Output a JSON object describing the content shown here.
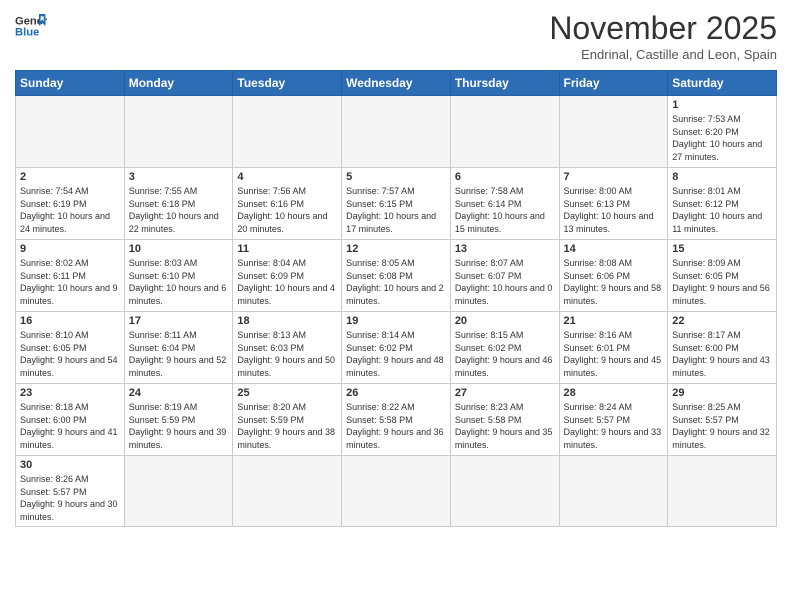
{
  "logo": {
    "line1": "General",
    "line2": "Blue"
  },
  "title": "November 2025",
  "subtitle": "Endrinal, Castille and Leon, Spain",
  "weekdays": [
    "Sunday",
    "Monday",
    "Tuesday",
    "Wednesday",
    "Thursday",
    "Friday",
    "Saturday"
  ],
  "weeks": [
    [
      {
        "day": "",
        "info": ""
      },
      {
        "day": "",
        "info": ""
      },
      {
        "day": "",
        "info": ""
      },
      {
        "day": "",
        "info": ""
      },
      {
        "day": "",
        "info": ""
      },
      {
        "day": "",
        "info": ""
      },
      {
        "day": "1",
        "info": "Sunrise: 7:53 AM\nSunset: 6:20 PM\nDaylight: 10 hours\nand 27 minutes."
      }
    ],
    [
      {
        "day": "2",
        "info": "Sunrise: 7:54 AM\nSunset: 6:19 PM\nDaylight: 10 hours\nand 24 minutes."
      },
      {
        "day": "3",
        "info": "Sunrise: 7:55 AM\nSunset: 6:18 PM\nDaylight: 10 hours\nand 22 minutes."
      },
      {
        "day": "4",
        "info": "Sunrise: 7:56 AM\nSunset: 6:16 PM\nDaylight: 10 hours\nand 20 minutes."
      },
      {
        "day": "5",
        "info": "Sunrise: 7:57 AM\nSunset: 6:15 PM\nDaylight: 10 hours\nand 17 minutes."
      },
      {
        "day": "6",
        "info": "Sunrise: 7:58 AM\nSunset: 6:14 PM\nDaylight: 10 hours\nand 15 minutes."
      },
      {
        "day": "7",
        "info": "Sunrise: 8:00 AM\nSunset: 6:13 PM\nDaylight: 10 hours\nand 13 minutes."
      },
      {
        "day": "8",
        "info": "Sunrise: 8:01 AM\nSunset: 6:12 PM\nDaylight: 10 hours\nand 11 minutes."
      }
    ],
    [
      {
        "day": "9",
        "info": "Sunrise: 8:02 AM\nSunset: 6:11 PM\nDaylight: 10 hours\nand 9 minutes."
      },
      {
        "day": "10",
        "info": "Sunrise: 8:03 AM\nSunset: 6:10 PM\nDaylight: 10 hours\nand 6 minutes."
      },
      {
        "day": "11",
        "info": "Sunrise: 8:04 AM\nSunset: 6:09 PM\nDaylight: 10 hours\nand 4 minutes."
      },
      {
        "day": "12",
        "info": "Sunrise: 8:05 AM\nSunset: 6:08 PM\nDaylight: 10 hours\nand 2 minutes."
      },
      {
        "day": "13",
        "info": "Sunrise: 8:07 AM\nSunset: 6:07 PM\nDaylight: 10 hours\nand 0 minutes."
      },
      {
        "day": "14",
        "info": "Sunrise: 8:08 AM\nSunset: 6:06 PM\nDaylight: 9 hours\nand 58 minutes."
      },
      {
        "day": "15",
        "info": "Sunrise: 8:09 AM\nSunset: 6:05 PM\nDaylight: 9 hours\nand 56 minutes."
      }
    ],
    [
      {
        "day": "16",
        "info": "Sunrise: 8:10 AM\nSunset: 6:05 PM\nDaylight: 9 hours\nand 54 minutes."
      },
      {
        "day": "17",
        "info": "Sunrise: 8:11 AM\nSunset: 6:04 PM\nDaylight: 9 hours\nand 52 minutes."
      },
      {
        "day": "18",
        "info": "Sunrise: 8:13 AM\nSunset: 6:03 PM\nDaylight: 9 hours\nand 50 minutes."
      },
      {
        "day": "19",
        "info": "Sunrise: 8:14 AM\nSunset: 6:02 PM\nDaylight: 9 hours\nand 48 minutes."
      },
      {
        "day": "20",
        "info": "Sunrise: 8:15 AM\nSunset: 6:02 PM\nDaylight: 9 hours\nand 46 minutes."
      },
      {
        "day": "21",
        "info": "Sunrise: 8:16 AM\nSunset: 6:01 PM\nDaylight: 9 hours\nand 45 minutes."
      },
      {
        "day": "22",
        "info": "Sunrise: 8:17 AM\nSunset: 6:00 PM\nDaylight: 9 hours\nand 43 minutes."
      }
    ],
    [
      {
        "day": "23",
        "info": "Sunrise: 8:18 AM\nSunset: 6:00 PM\nDaylight: 9 hours\nand 41 minutes."
      },
      {
        "day": "24",
        "info": "Sunrise: 8:19 AM\nSunset: 5:59 PM\nDaylight: 9 hours\nand 39 minutes."
      },
      {
        "day": "25",
        "info": "Sunrise: 8:20 AM\nSunset: 5:59 PM\nDaylight: 9 hours\nand 38 minutes."
      },
      {
        "day": "26",
        "info": "Sunrise: 8:22 AM\nSunset: 5:58 PM\nDaylight: 9 hours\nand 36 minutes."
      },
      {
        "day": "27",
        "info": "Sunrise: 8:23 AM\nSunset: 5:58 PM\nDaylight: 9 hours\nand 35 minutes."
      },
      {
        "day": "28",
        "info": "Sunrise: 8:24 AM\nSunset: 5:57 PM\nDaylight: 9 hours\nand 33 minutes."
      },
      {
        "day": "29",
        "info": "Sunrise: 8:25 AM\nSunset: 5:57 PM\nDaylight: 9 hours\nand 32 minutes."
      }
    ],
    [
      {
        "day": "30",
        "info": "Sunrise: 8:26 AM\nSunset: 5:57 PM\nDaylight: 9 hours\nand 30 minutes."
      },
      {
        "day": "",
        "info": ""
      },
      {
        "day": "",
        "info": ""
      },
      {
        "day": "",
        "info": ""
      },
      {
        "day": "",
        "info": ""
      },
      {
        "day": "",
        "info": ""
      },
      {
        "day": "",
        "info": ""
      }
    ]
  ],
  "colors": {
    "header_bg": "#2d6db5",
    "empty_bg": "#f0f0f0"
  }
}
